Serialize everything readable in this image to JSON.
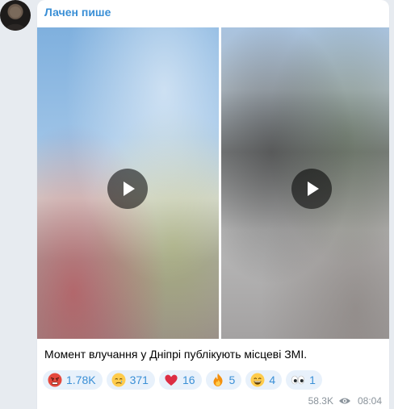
{
  "message": {
    "author": "Лачен пише",
    "caption": "Момент влучання у Дніпрі публікують місцеві ЗМІ.",
    "views": "58.3K",
    "time": "08:04"
  },
  "media": [
    {
      "type": "video",
      "icon": "play-icon"
    },
    {
      "type": "video",
      "icon": "play-icon"
    }
  ],
  "reactions": [
    {
      "emoji": "angry-face",
      "count": "1.78K"
    },
    {
      "emoji": "crying-face",
      "count": "371"
    },
    {
      "emoji": "red-heart",
      "count": "16"
    },
    {
      "emoji": "fire",
      "count": "5"
    },
    {
      "emoji": "grinning-face",
      "count": "4"
    },
    {
      "emoji": "eyes",
      "count": "1"
    }
  ],
  "colors": {
    "author": "#3a8fd6",
    "reaction_bg": "#e8f1fb",
    "reaction_text": "#3a8fd6",
    "meta_text": "#8a939b",
    "chat_bg": "#e7ebf0"
  }
}
